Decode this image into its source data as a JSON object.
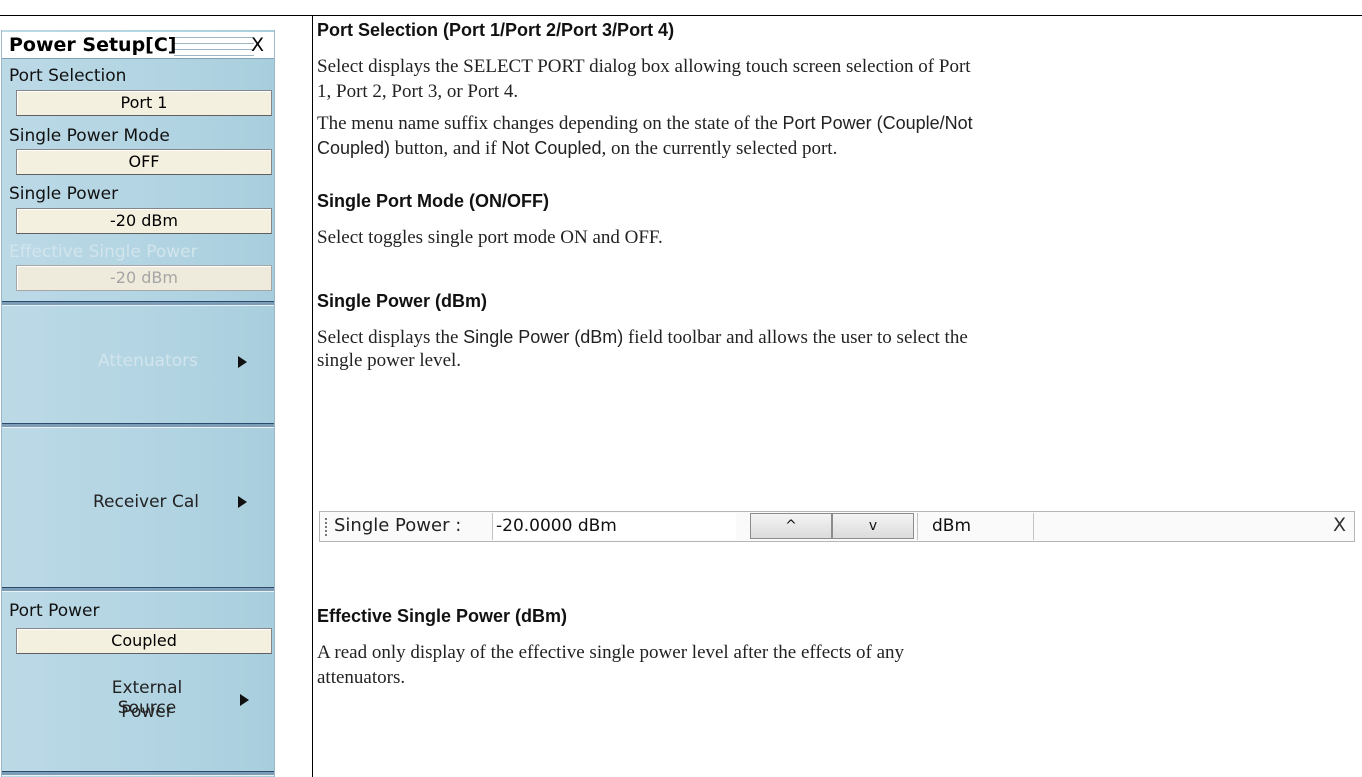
{
  "menu": {
    "title": "Power Setup[C]",
    "close_label": "X",
    "port_selection": {
      "label": "Port Selection",
      "value": "Port 1"
    },
    "single_power_mode": {
      "label": "Single Power Mode",
      "value": "OFF"
    },
    "single_power": {
      "label": "Single Power",
      "value": "-20  dBm"
    },
    "effective_single_power": {
      "label": "Effective Single Power",
      "value": "-20  dBm"
    },
    "attenuators_label": "Attenuators",
    "receiver_cal_label": "Receiver Cal",
    "port_power": {
      "label": "Port Power",
      "value": "Coupled"
    },
    "external_source_power": {
      "line1": "External Source",
      "line2": "Power"
    }
  },
  "doc": {
    "port_selection": {
      "heading": "Port Selection (Port 1/Port 2/Port 3/Port 4)",
      "p1_line1": "Select displays the SELECT PORT dialog box allowing touch screen selection of Port",
      "p1_line2": "1, Port 2, Port 3, or Port 4.",
      "p2_a": "The menu name suffix changes depending on the state of the ",
      "p2_ui1": "Port Power (Couple/Not",
      "p2_ui1b": "Coupled)",
      "p2_b": " button, and if ",
      "p2_ui2": "Not Coupled",
      "p2_c": ", on the currently selected port."
    },
    "single_port_mode": {
      "heading": "Single Port Mode (ON/OFF)",
      "text": "Select toggles single port mode ON and OFF."
    },
    "single_power": {
      "heading": "Single Power (dBm)",
      "a": "Select displays the ",
      "ui": "Single Power (dBm)",
      "b": " field toolbar and allows the user to select the",
      "line2": "single power level."
    },
    "effective_single_power": {
      "heading": "Effective Single Power (dBm)",
      "line1": "A read only display of the effective single power level after the effects of any",
      "line2": "attenuators."
    }
  },
  "toolbar": {
    "label": "Single Power  :",
    "value": "-20.0000  dBm",
    "up_glyph": "^",
    "down_glyph": "v",
    "unit": "dBm",
    "close_label": "X"
  }
}
